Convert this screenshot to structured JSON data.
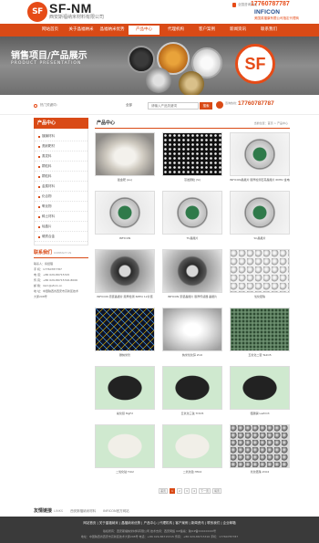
{
  "header": {
    "logo_mark": "SF",
    "logo_text": "SF-NM",
    "logo_sub": "西安斯福纳米材料有限公司",
    "phone_label": "全国咨询热线",
    "phone": "17760787787",
    "partner": "INFICON",
    "partner_sub": "美国英福康有限公司指定代理商"
  },
  "nav": {
    "items": [
      "网站首页",
      "关于晶福纳米",
      "晶福纳米优势",
      "产品中心",
      "代理机构",
      "客户案例",
      "新闻资讯",
      "联系我们"
    ],
    "active_index": 3
  },
  "banner": {
    "title": "销售项目/产品展示",
    "subtitle": "PRODUCT PRESENTATION",
    "logo": "SF"
  },
  "search": {
    "hot_label": "热门关键词：",
    "select_label": "全部",
    "placeholder": "请输入产品关键词",
    "button": "搜索",
    "hotline_label": "咨询热线：",
    "hotline": "17760787787"
  },
  "sidebar": {
    "title": "产品中心",
    "items": [
      "镀膜材料",
      "溅射靶材",
      "蒸发料",
      "颗粒料",
      "颗粒料",
      "金属材料",
      "化合物",
      "氧化物",
      "稀土材料",
      "硅晶片",
      "硬质合金"
    ]
  },
  "contact": {
    "title": "联系我们",
    "title_en": "CONTACT US",
    "lines": [
      "联系人：蒋经理",
      "手 机：17760787787",
      "电 话：+86 029-86715315",
      "传 真：+86 029-86715316-8006",
      "邮 箱：lixm@sfnm.cn",
      "地 址：中国陕西省西安市高新区技术",
      "大厦208号"
    ]
  },
  "main": {
    "title": "产品中心",
    "breadcrumb": "当前位置：首页 > 产品中心"
  },
  "products": [
    {
      "caption": "镀金靶 (Au)",
      "img": "white-cone"
    },
    {
      "caption": "蒸发颗粒 (Si)",
      "img": "white-pellets"
    },
    {
      "caption": "INFICON晶振片 膜厚检测石英晶振片 6MHz 金电极",
      "img": "crystal-green"
    },
    {
      "caption": "INFICON",
      "img": "crystal-green"
    },
    {
      "caption": "TC晶振片",
      "img": "crystal-green"
    },
    {
      "caption": "SC晶振片",
      "img": "crystal-green"
    },
    {
      "caption": "INFICON 原装晶振片 膜厚检测 6MHz 12片装",
      "img": "crystal-dark"
    },
    {
      "caption": "INFICON 原装晶振片 膜厚传感器 晶振片",
      "img": "crystal-dark"
    },
    {
      "caption": "氧化锆珠",
      "img": "white-balls"
    },
    {
      "caption": "碳纳米管",
      "img": "nanotube"
    },
    {
      "caption": "纳米氧化锌 ZnO",
      "img": "white-powder"
    },
    {
      "caption": "五氧化二钽 Ta2O5",
      "img": "green-pellets"
    },
    {
      "caption": "氟化镁 MgF2",
      "img": "black-pellets"
    },
    {
      "caption": "五氧化三钛 Ti3O5",
      "img": "black-pellets"
    },
    {
      "caption": "锆酸镧 LaZrO3",
      "img": "black-pellets"
    },
    {
      "caption": "二氧化钛 TiO2",
      "img": "white-pellets2"
    },
    {
      "caption": "二氧化铪 HfO2",
      "img": "white-pellets2"
    },
    {
      "caption": "氧化锆珠 ZrO2",
      "img": "gray-balls"
    }
  ],
  "pager": {
    "items": [
      "首页",
      "1",
      "2",
      "3",
      "4",
      "下一页",
      "尾页"
    ],
    "current": "1"
  },
  "links": {
    "title": "友情链接",
    "title_en": "LINKS",
    "items": [
      "西安斯福纳米材料",
      "INFICON官方网站"
    ]
  },
  "footer": {
    "nav": "网站首页 | 关于晶福纳米 | 晶福纳米优势 | 产品中心 | 代理机构 | 客户案例 | 新闻资讯 | 联系我们 | 企业邮箱",
    "line1": "版权所有：西安斯福纳米材料有限公司 技术支持：西安网络 ICP备案：陕ICP备XXXXXXXX号",
    "line2": "地址：中国陕西省西安市高新区技术大厦208号 电话：+86 029-86715315 传真：+86 029-86715316 手机：17760787787"
  }
}
